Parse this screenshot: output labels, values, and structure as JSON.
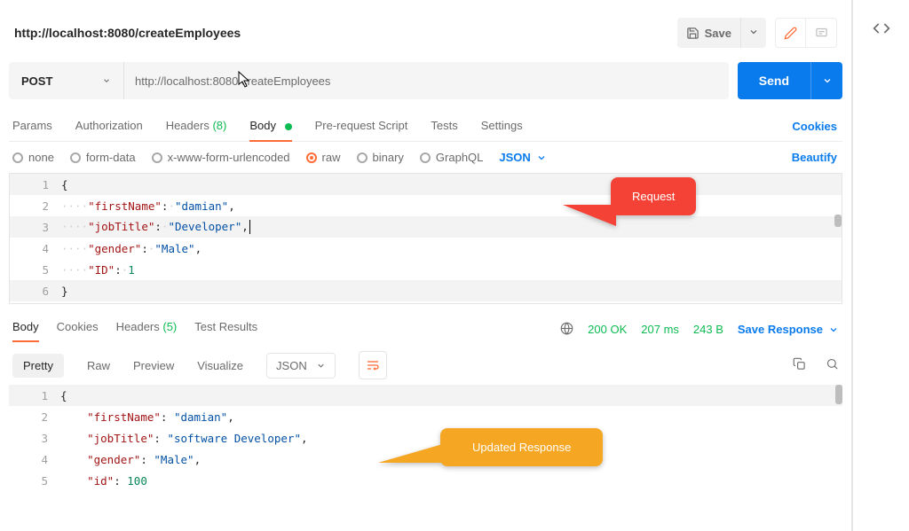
{
  "title": "http://localhost:8080/createEmployees",
  "save_label": "Save",
  "method": "POST",
  "url_display": "http://localhost:8080/createEmployees",
  "send_label": "Send",
  "tabs": {
    "params": "Params",
    "authorization": "Authorization",
    "headers": "Headers",
    "headers_count": "(8)",
    "body": "Body",
    "prerequest": "Pre-request Script",
    "tests": "Tests",
    "settings": "Settings"
  },
  "cookies": "Cookies",
  "body_types": {
    "none": "none",
    "formdata": "form-data",
    "xwww": "x-www-form-urlencoded",
    "raw": "raw",
    "binary": "binary",
    "graphql": "GraphQL",
    "format": "JSON"
  },
  "beautify": "Beautify",
  "request_body": {
    "firstName": "damian",
    "jobTitle": "Developer",
    "gender": "Male",
    "ID": 1
  },
  "callout_request": "Request",
  "response_tabs": {
    "body": "Body",
    "cookies": "Cookies",
    "headers": "Headers",
    "headers_count": "(5)",
    "test_results": "Test Results"
  },
  "response_meta": {
    "status": "200 OK",
    "time": "207 ms",
    "size": "243 B",
    "save_response": "Save Response"
  },
  "response_toolbar": {
    "pretty": "Pretty",
    "raw": "Raw",
    "preview": "Preview",
    "visualize": "Visualize",
    "format": "JSON"
  },
  "response_body": {
    "firstName": "damian",
    "jobTitle": "software Developer",
    "gender": "Male",
    "id": 100
  },
  "callout_response": "Updated Response"
}
